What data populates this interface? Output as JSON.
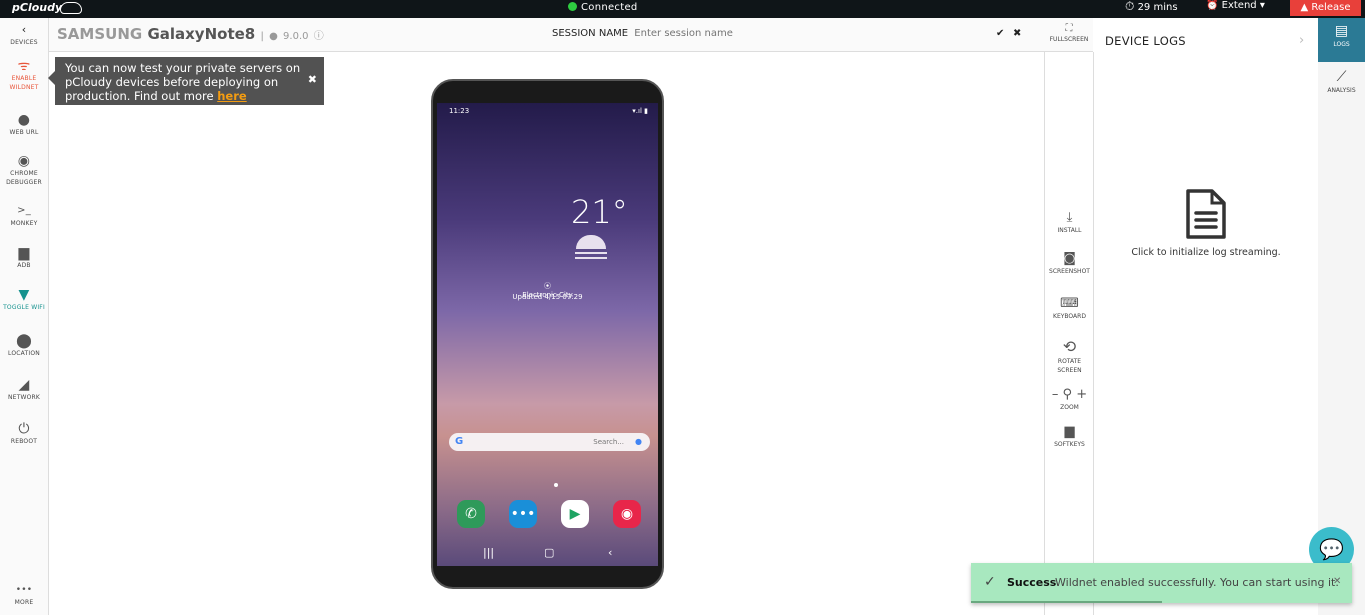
{
  "topbar": {
    "logo": "pCloudy",
    "connection_status": "Connected",
    "timer": "29 mins",
    "extend_label": "Extend",
    "release_label": "Release"
  },
  "left_sidebar": {
    "items": [
      {
        "label": "DEVICES",
        "icon": "chevron-left-icon"
      },
      {
        "label": "ENABLE WILDNET",
        "icon": "antenna-icon"
      },
      {
        "label": "WEB URL",
        "icon": "globe-icon"
      },
      {
        "label": "CHROME DEBUGGER",
        "icon": "chrome-icon"
      },
      {
        "label": "MONKEY",
        "icon": "terminal-icon"
      },
      {
        "label": "ADB",
        "icon": "android-icon"
      },
      {
        "label": "TOGGLE WIFI",
        "icon": "wifi-icon"
      },
      {
        "label": "LOCATION",
        "icon": "location-pin-icon"
      },
      {
        "label": "NETWORK",
        "icon": "signal-icon"
      },
      {
        "label": "REBOOT",
        "icon": "power-icon"
      },
      {
        "label": "MORE",
        "icon": "more-icon"
      }
    ]
  },
  "header": {
    "brand": "SAMSUNG",
    "model": "GalaxyNote8",
    "os_version": "9.0.0",
    "session_label": "SESSION NAME",
    "session_placeholder": "Enter session name",
    "session_value": "",
    "fullscreen_label": "FULLSCREEN"
  },
  "tooltip": {
    "text": "You can now test your private servers on pCloudy devices before deploying on production. Find out more ",
    "link": "here"
  },
  "device_screen": {
    "time": "11:23",
    "temperature": "21°",
    "location": "Electronic City",
    "updated": "Updated 4/15 07:29",
    "search_placeholder": "Search..."
  },
  "right_tools": {
    "items": [
      {
        "label": "INSTALL",
        "icon": "install-icon"
      },
      {
        "label": "SCREENSHOT",
        "icon": "camera-icon"
      },
      {
        "label": "KEYBOARD",
        "icon": "keyboard-icon"
      },
      {
        "label": "ROTATE SCREEN",
        "icon": "rotate-icon"
      },
      {
        "label": "ZOOM",
        "icon": "zoom-icon"
      },
      {
        "label": "SOFTKEYS",
        "icon": "android-icon"
      }
    ]
  },
  "logs_panel": {
    "title": "DEVICE LOGS",
    "hint": "Click to initialize log streaming."
  },
  "right_sidebar": {
    "items": [
      {
        "label": "LOGS",
        "icon": "logs-icon",
        "active": true
      },
      {
        "label": "ANALYSIS",
        "icon": "analysis-icon",
        "active": false
      }
    ]
  },
  "toast": {
    "title": "Success",
    "message": "Wildnet enabled successfully. You can start using it.",
    "progress": 0.5
  },
  "colors": {
    "accent_teal": "#2b7a95",
    "release_red": "#e8403a",
    "wildnet_orange": "#e8553a",
    "wifi_teal": "#15928e",
    "toast_green": "#a8e8bf"
  }
}
